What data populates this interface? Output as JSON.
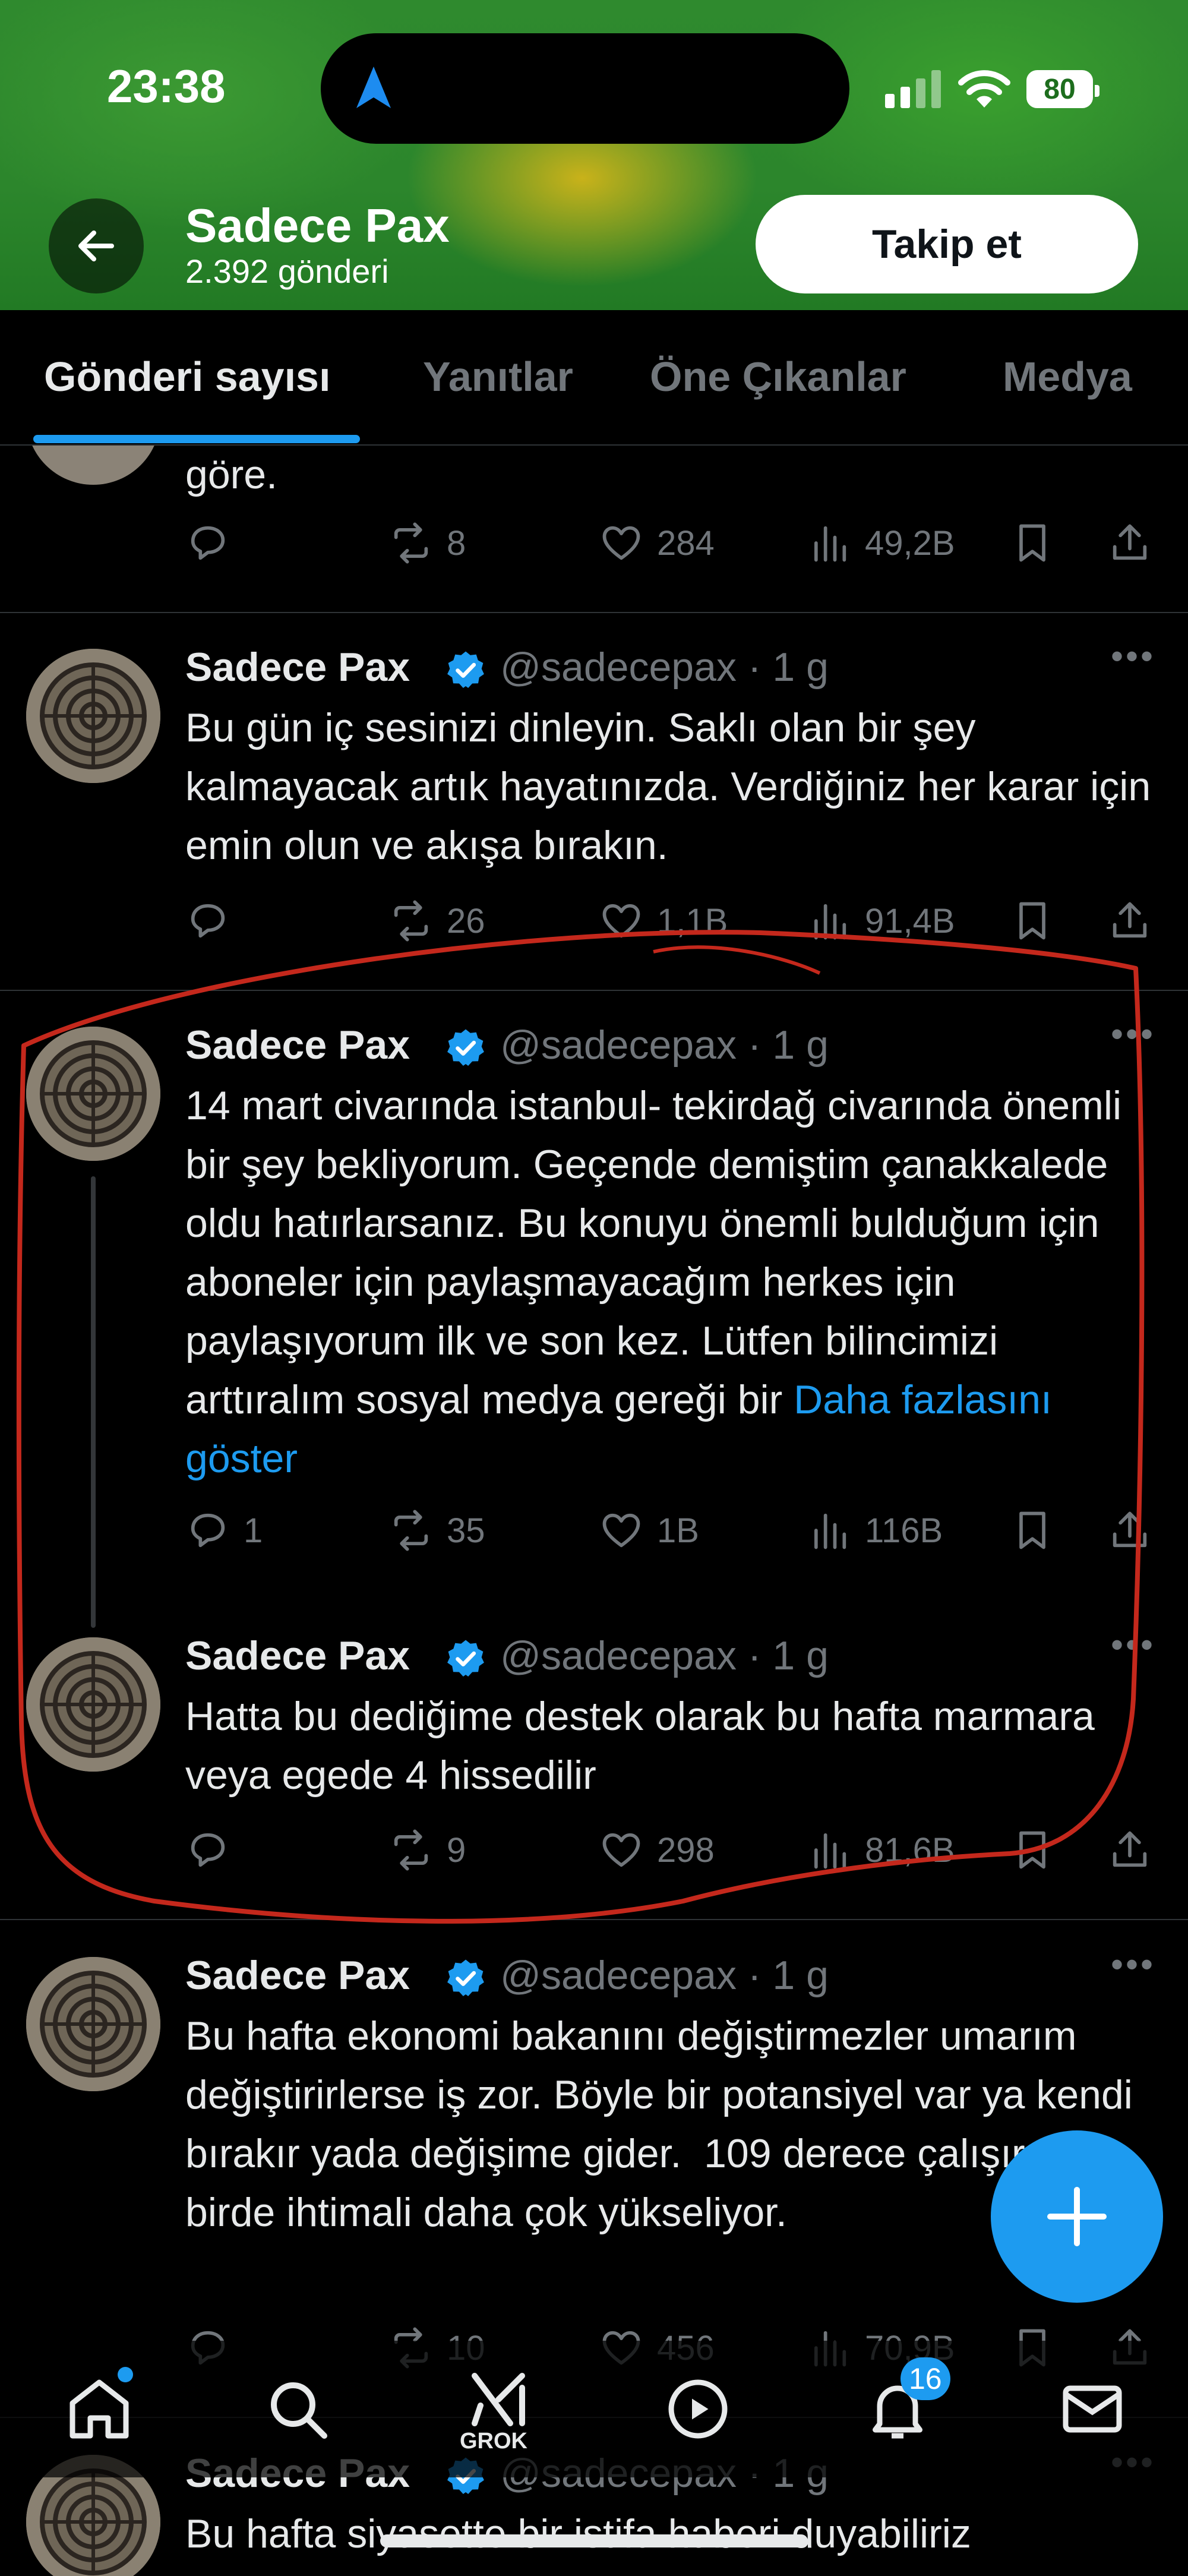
{
  "status_bar": {
    "time": "23:38",
    "battery": "80"
  },
  "header": {
    "name": "Sadece Pax",
    "post_count": "2.392 gönderi",
    "follow_label": "Takip et"
  },
  "tabs": [
    {
      "label": "Gönderi sayısı",
      "active": true
    },
    {
      "label": "Yanıtlar",
      "active": false
    },
    {
      "label": "Öne Çıkanlar",
      "active": false
    },
    {
      "label": "Medya",
      "active": false
    }
  ],
  "tweets": [
    {
      "text": "göre.",
      "replies": "",
      "reposts": "8",
      "likes": "284",
      "views": "49,2B"
    },
    {
      "name": "Sadece Pax",
      "handle": "@sadecepax · 1 g",
      "text": "Bu gün iç sesinizi dinleyin. Saklı olan bir şey kalmayacak artık hayatınızda. Verdiğiniz her karar için emin olun ve akışa bırakın.",
      "replies": "",
      "reposts": "26",
      "likes": "1,1B",
      "views": "91,4B"
    },
    {
      "name": "Sadece Pax",
      "handle": "@sadecepax · 1 g",
      "text": "14 mart civarında istanbul- tekirdağ civarında önemli bir şey bekliyorum. Geçende demiştim çanakkalede oldu hatırlarsanız. Bu konuyu önemli bulduğum için aboneler için paylaşmayacağım herkes için paylaşıyorum ilk ve son kez. Lütfen bilincimizi arttıralım sosyal medya gereği bir ",
      "show_more": "Daha fazlasını göster",
      "replies": "1",
      "reposts": "35",
      "likes": "1B",
      "views": "116B"
    },
    {
      "name": "Sadece Pax",
      "handle": "@sadecepax · 1 g",
      "text": "Hatta bu dediğime destek olarak bu hafta marmara veya egede 4 hissedilir",
      "replies": "",
      "reposts": "9",
      "likes": "298",
      "views": "81,6B"
    },
    {
      "name": "Sadece Pax",
      "handle": "@sadecepax · 1 g",
      "text": "Bu hafta ekonomi bakanını değiştirmezler umarım değiştirirlerse iş zor. Böyle bir potansiyel var ya kendi bırakır yada değişime gider.  109 derece çalışırsa birde ihtimali daha çok yükseliyor.",
      "replies": "",
      "reposts": "10",
      "likes": "456",
      "views": "70,9B"
    },
    {
      "name": "Sadece Pax",
      "handle": "@sadecepax · 1 g",
      "text": "Bu hafta siyasette bir istifa haberi duyabiliriz"
    }
  ],
  "nav": {
    "grok_label": "GROK",
    "notifications_count": "16"
  },
  "annotation_color": "#c4281c",
  "accent_color": "#1d9bf0"
}
